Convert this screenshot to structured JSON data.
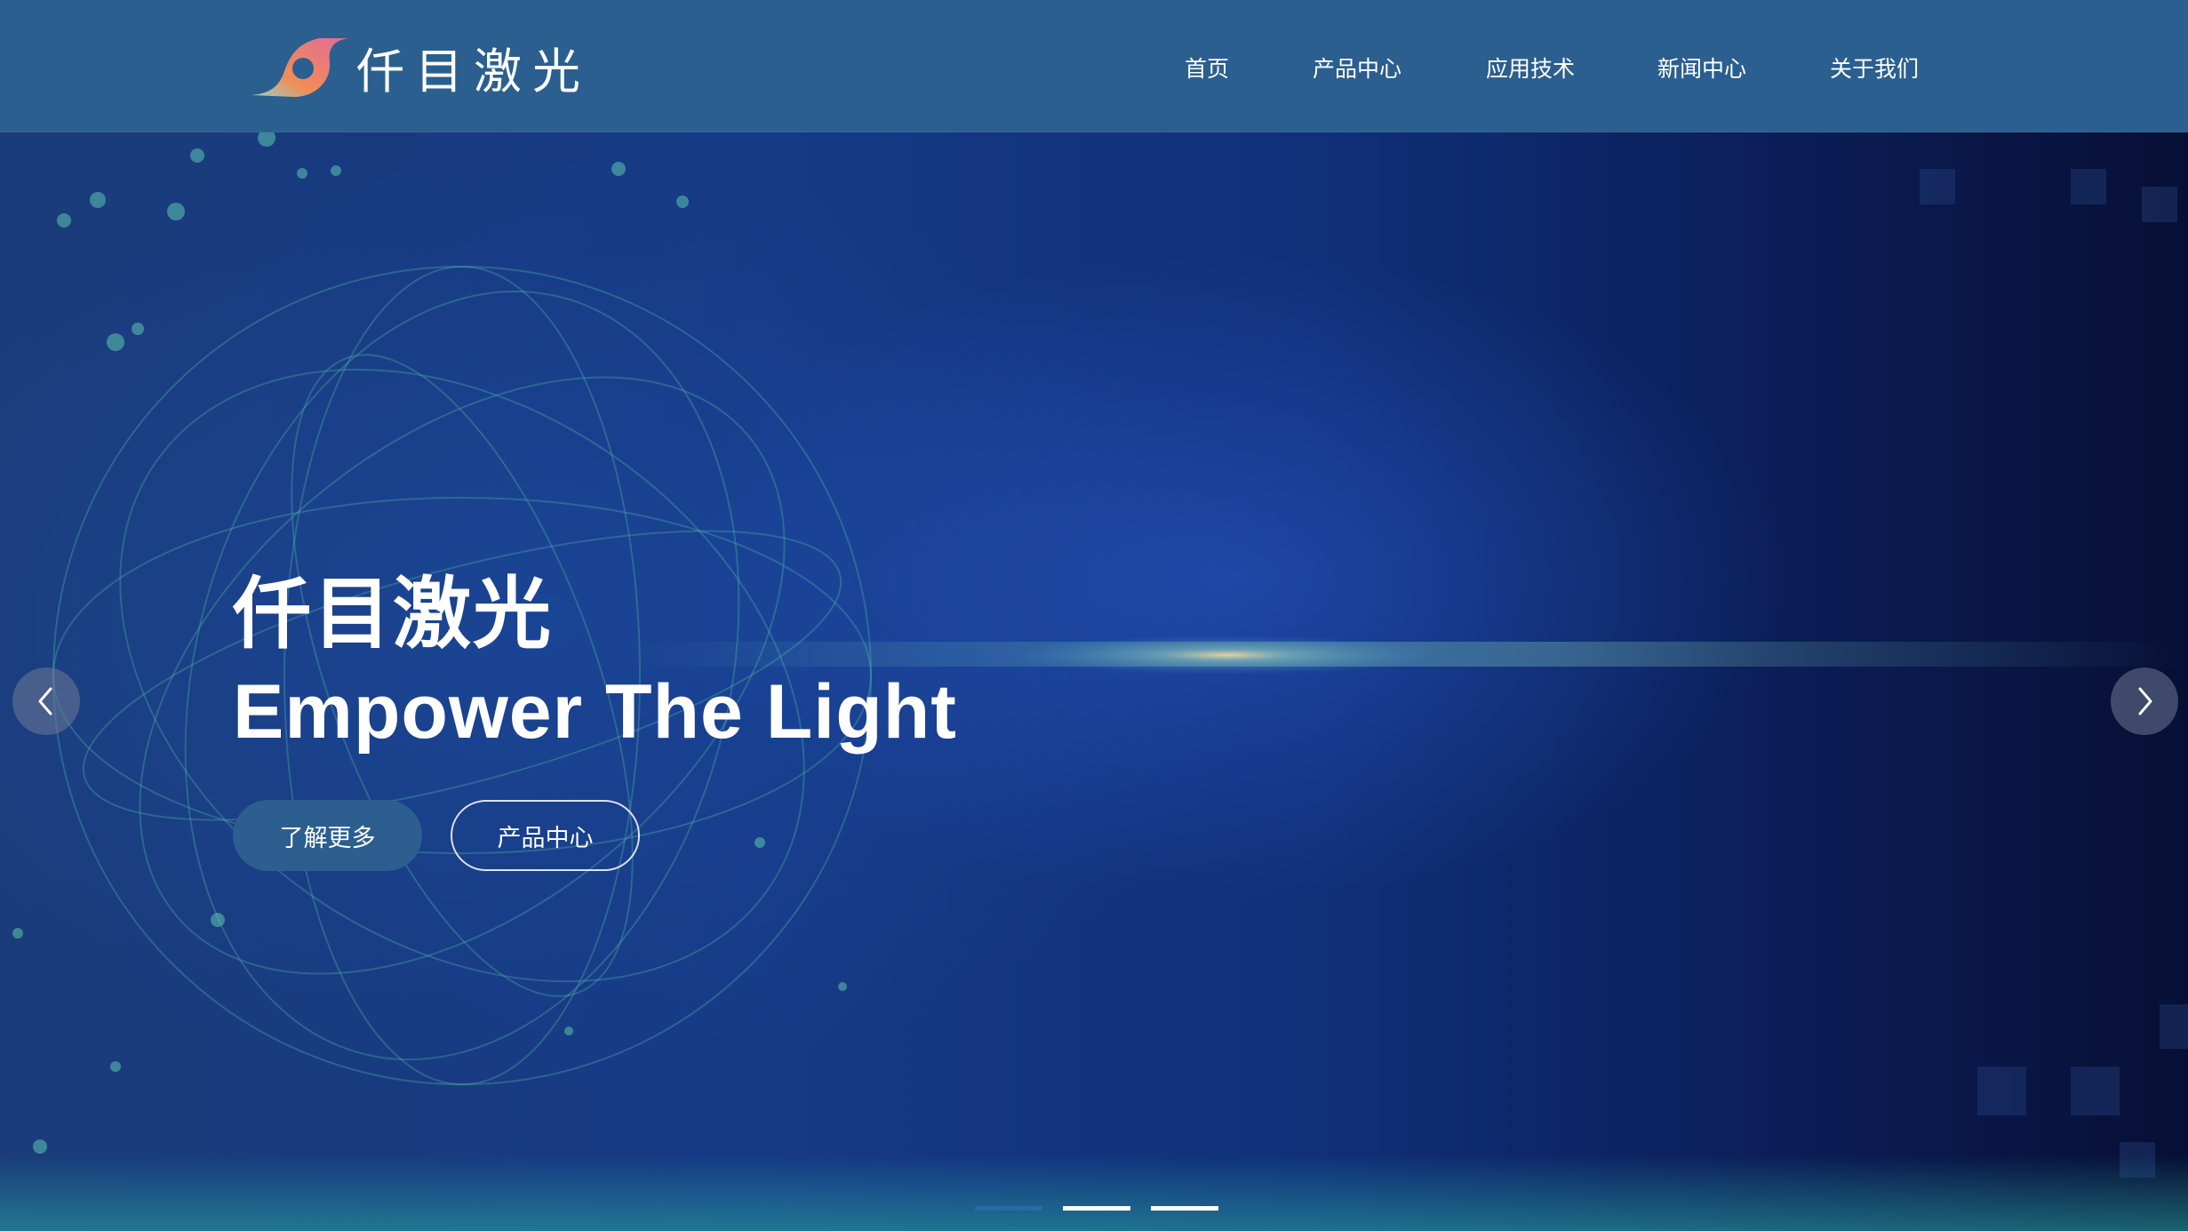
{
  "brand": {
    "name": "仟目激光",
    "colors": {
      "nav_background": "#2b5f8f",
      "logo_gradient_start": "#f28c55",
      "logo_gradient_end": "#e06c9a",
      "primary_button": "#2c5e90"
    }
  },
  "nav": {
    "items": [
      {
        "label": "首页"
      },
      {
        "label": "产品中心"
      },
      {
        "label": "应用技术"
      },
      {
        "label": "新闻中心"
      },
      {
        "label": "关于我们"
      }
    ]
  },
  "hero": {
    "title": "仟目激光",
    "subtitle": "Empower The Light",
    "primary_button": "了解更多",
    "secondary_button": "产品中心"
  },
  "carousel": {
    "prev_icon": "chevron-left-icon",
    "next_icon": "chevron-right-icon",
    "slide_count": 3,
    "active_slide": 1
  }
}
